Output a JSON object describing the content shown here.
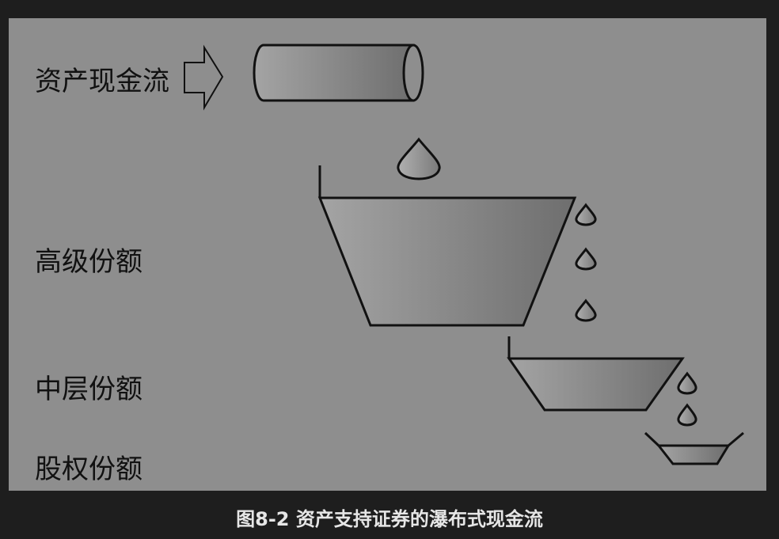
{
  "labels": {
    "asset_cash_flow": "资产现金流",
    "senior_tranche": "高级份额",
    "mezzanine_tranche": "中层份额",
    "equity_tranche": "股权份额"
  },
  "caption": "图8-2 资产支持证券的瀑布式现金流",
  "colors": {
    "page_background": "#1e1e1e",
    "figure_background": "#8e8e8e",
    "caption_text": "#e6e6e6"
  }
}
